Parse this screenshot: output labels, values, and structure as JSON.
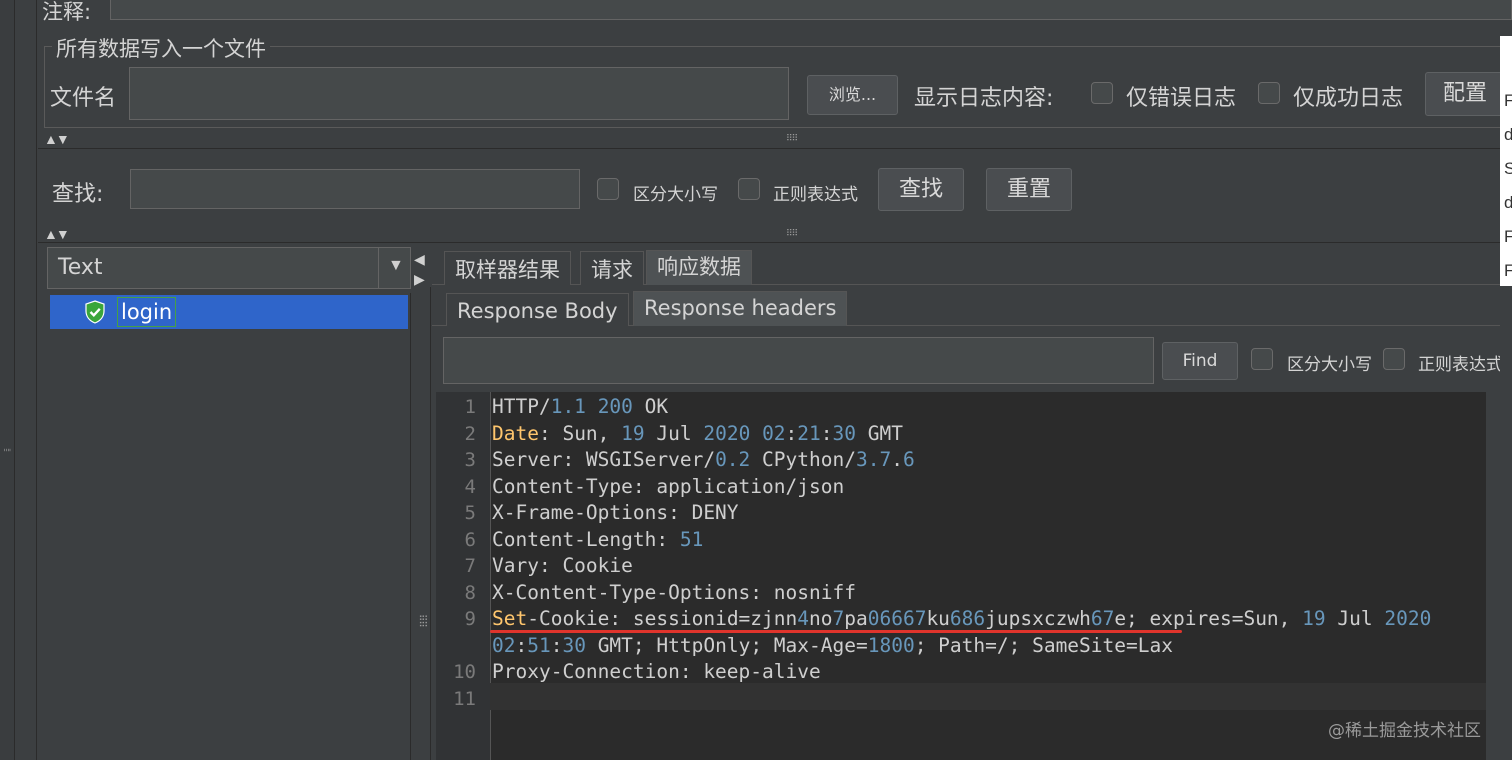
{
  "top": {
    "annotation_label": "注释:",
    "write_all_label": "所有数据写入一个文件",
    "filename_label": "文件名",
    "browse_label": "浏览...",
    "show_log_label": "显示日志内容:",
    "errors_only_label": "仅错误日志",
    "success_only_label": "仅成功日志",
    "config_label": "配置"
  },
  "search": {
    "label": "查找:",
    "case_label": "区分大小写",
    "regex_label": "正则表达式",
    "find_label": "查找",
    "reset_label": "重置"
  },
  "tree": {
    "renderer_selected": "Text",
    "items": [
      {
        "label": "login",
        "status": "success"
      }
    ]
  },
  "tabs": {
    "main": [
      "取样器结果",
      "请求",
      "响应数据"
    ],
    "main_active": "响应数据",
    "sub": [
      "Response Body",
      "Response headers"
    ],
    "sub_active": "Response headers"
  },
  "response_find": {
    "find_label": "Find",
    "case_label": "区分大小写",
    "regex_label": "正则表达式"
  },
  "editor": {
    "line_numbers": [
      "1",
      "2",
      "3",
      "4",
      "5",
      "6",
      "7",
      "8",
      "9",
      "10",
      "11"
    ],
    "lines": [
      "HTTP/1.1 200 OK",
      "Date: Sun, 19 Jul 2020 02:21:30 GMT",
      "Server: WSGIServer/0.2 CPython/3.7.6",
      "Content-Type: application/json",
      "X-Frame-Options: DENY",
      "Content-Length: 51",
      "Vary: Cookie",
      "X-Content-Type-Options: nosniff",
      "Set-Cookie: sessionid=zjnn4no7pa06667ku686jupsxczwh67e; expires=Sun, 19 Jul 2020",
      "02:51:30 GMT; HttpOnly; Max-Age=1800; Path=/; SameSite=Lax",
      "Proxy-Connection: keep-alive",
      ""
    ]
  },
  "watermark": "@稀土掘金技术社区",
  "right_edge_letters": [
    "F",
    "d",
    "S",
    "d",
    "F",
    "F"
  ],
  "colors": {
    "background": "#3c3f41",
    "selection": "#2f65ca",
    "underline": "#e0342c",
    "number": "#6897bb",
    "keyword": "#ffc66d"
  },
  "icons": [
    "shield-check-icon",
    "chevron-down-icon",
    "collapse-arrows-icon",
    "splitter-grip-icon"
  ]
}
